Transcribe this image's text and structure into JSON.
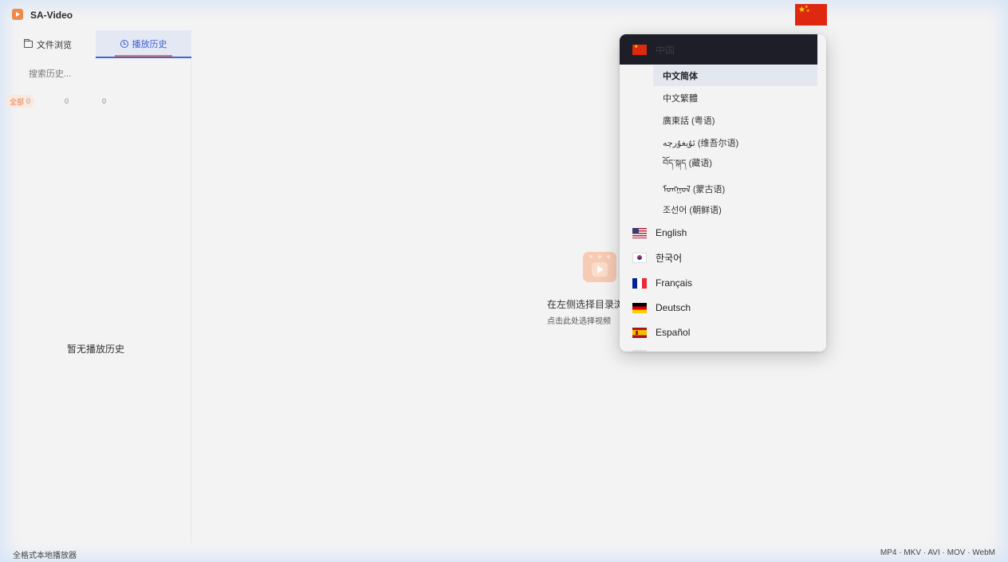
{
  "app": {
    "title": "SA-Video",
    "accent_color": "#f08a4b",
    "tab_active_color": "#3d5bd6"
  },
  "titlebar": {
    "lang_flag_icon": "china-flag-icon"
  },
  "sidebar": {
    "tabs": [
      {
        "label": "文件浏览",
        "icon": "folder-icon"
      },
      {
        "label": "播放历史",
        "icon": "clock-icon",
        "active": true
      }
    ],
    "search": {
      "placeholder": "搜索历史..."
    },
    "filters": [
      {
        "label": "全部",
        "count": "0",
        "active": true
      },
      {
        "label": "",
        "count": "0"
      },
      {
        "label": "",
        "count": "0"
      }
    ],
    "empty_text": "暂无播放历史"
  },
  "main": {
    "logo_icon": "video-play-icon",
    "hint_line_1": "在左侧选择目录浏",
    "hint_line_2": "点击此处选择视频"
  },
  "footer": {
    "left": "全格式本地播放器",
    "right": "MP4 · MKV · AVI · MOV · WebM"
  },
  "language_menu": {
    "header": {
      "label": "中国",
      "flag": "china-flag-icon"
    },
    "sub_items": [
      {
        "label": "中文简体",
        "selected": true
      },
      {
        "label": "中文繁體"
      },
      {
        "label": "廣東話 (粤语)"
      },
      {
        "label": "ئۇيغۇرچە (维吾尔语)"
      },
      {
        "label": "བོད་སྐད (藏语)"
      },
      {
        "label": "ᠮᠣᠩᠭᠣᠯ (蒙古语)"
      },
      {
        "label": "조선어 (朝鲜语)"
      }
    ],
    "items": [
      {
        "label": "English",
        "flag": "us-flag-icon"
      },
      {
        "label": "한국어",
        "flag": "korea-flag-icon"
      },
      {
        "label": "Français",
        "flag": "france-flag-icon"
      },
      {
        "label": "Deutsch",
        "flag": "germany-flag-icon"
      },
      {
        "label": "Español",
        "flag": "spain-flag-icon"
      }
    ]
  }
}
